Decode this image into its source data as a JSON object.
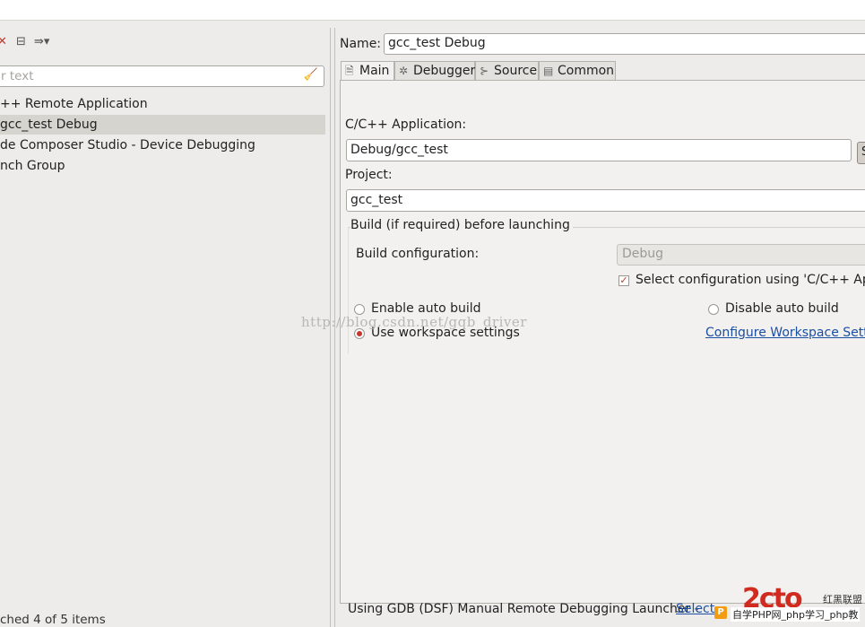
{
  "left": {
    "toolbar_icons": [
      "delete-icon",
      "collapse-all-icon",
      "filter-icon"
    ],
    "filter_placeholder": "r text",
    "tree": [
      {
        "label": "++ Remote Application",
        "selected": false
      },
      {
        "label": "gcc_test Debug",
        "selected": true
      },
      {
        "label": "de Composer Studio - Device Debugging",
        "selected": false
      },
      {
        "label": "nch Group",
        "selected": false
      }
    ],
    "status": "ched 4 of 5 items"
  },
  "right": {
    "name_label": "Name:",
    "name_value": "gcc_test Debug",
    "tabs": [
      {
        "label": "Main",
        "icon": "main-tab-icon",
        "active": true
      },
      {
        "label": "Debugger",
        "icon": "debugger-tab-icon",
        "active": false
      },
      {
        "label": "Source",
        "icon": "source-tab-icon",
        "active": false
      },
      {
        "label": "Common",
        "icon": "common-tab-icon",
        "active": false
      }
    ],
    "app_label": "C/C++ Application:",
    "app_value": "Debug/gcc_test",
    "search_label": "S",
    "project_label": "Project:",
    "project_value": "gcc_test",
    "build": {
      "title": "Build (if required) before launching",
      "config_label": "Build configuration:",
      "config_value": "Debug",
      "select_config_label": "Select configuration using 'C/C++ Appli",
      "select_config_checked": true,
      "enable_auto": "Enable auto build",
      "disable_auto": "Disable auto build",
      "use_workspace": "Use workspace settings",
      "configure_link": "Configure Workspace Settin"
    }
  },
  "watermark": "http://blog.csdn.net/gqb_driver",
  "footer": {
    "launcher_text": "Using GDB (DSF) Manual Remote Debugging Launcher -",
    "select_link": "Select"
  },
  "logo": {
    "mark": "2cto",
    "cn": "红黑联盟",
    "badge": "P",
    "sub": "自学PHP网_php学习_php教"
  },
  "colors": {
    "accent_red": "#c0392b",
    "link_blue": "#1a4fa3"
  }
}
